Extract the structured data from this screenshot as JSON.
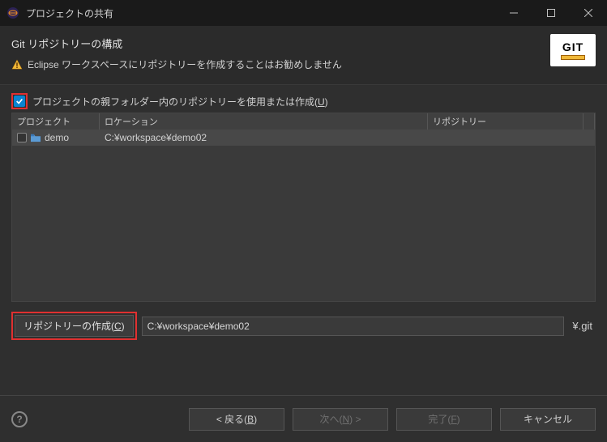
{
  "window": {
    "title": "プロジェクトの共有"
  },
  "header": {
    "subtitle": "Git リポジトリーの構成",
    "warning": "Eclipse ワークスペースにリポジトリーを作成することはお勧めしません",
    "badge": "GIT"
  },
  "checkbox": {
    "label_pre": "プロジェクトの親フォルダー内のリポジトリーを使用または作成(",
    "label_key": "U",
    "label_post": ")"
  },
  "table": {
    "columns": {
      "project": "プロジェクト",
      "location": "ロケーション",
      "repository": "リポジトリー"
    },
    "rows": [
      {
        "project": "demo",
        "location": "C:¥workspace¥demo02",
        "repository": ""
      }
    ]
  },
  "create": {
    "button_pre": "リポジトリーの作成(",
    "button_key": "C",
    "button_post": ")",
    "path": "C:¥workspace¥demo02",
    "suffix": "¥.git"
  },
  "footer": {
    "back_pre": "< 戻る(",
    "back_key": "B",
    "back_post": ")",
    "next_pre": "次へ(",
    "next_key": "N",
    "next_post": ") >",
    "finish_pre": "完了(",
    "finish_key": "F",
    "finish_post": ")",
    "cancel": "キャンセル"
  }
}
